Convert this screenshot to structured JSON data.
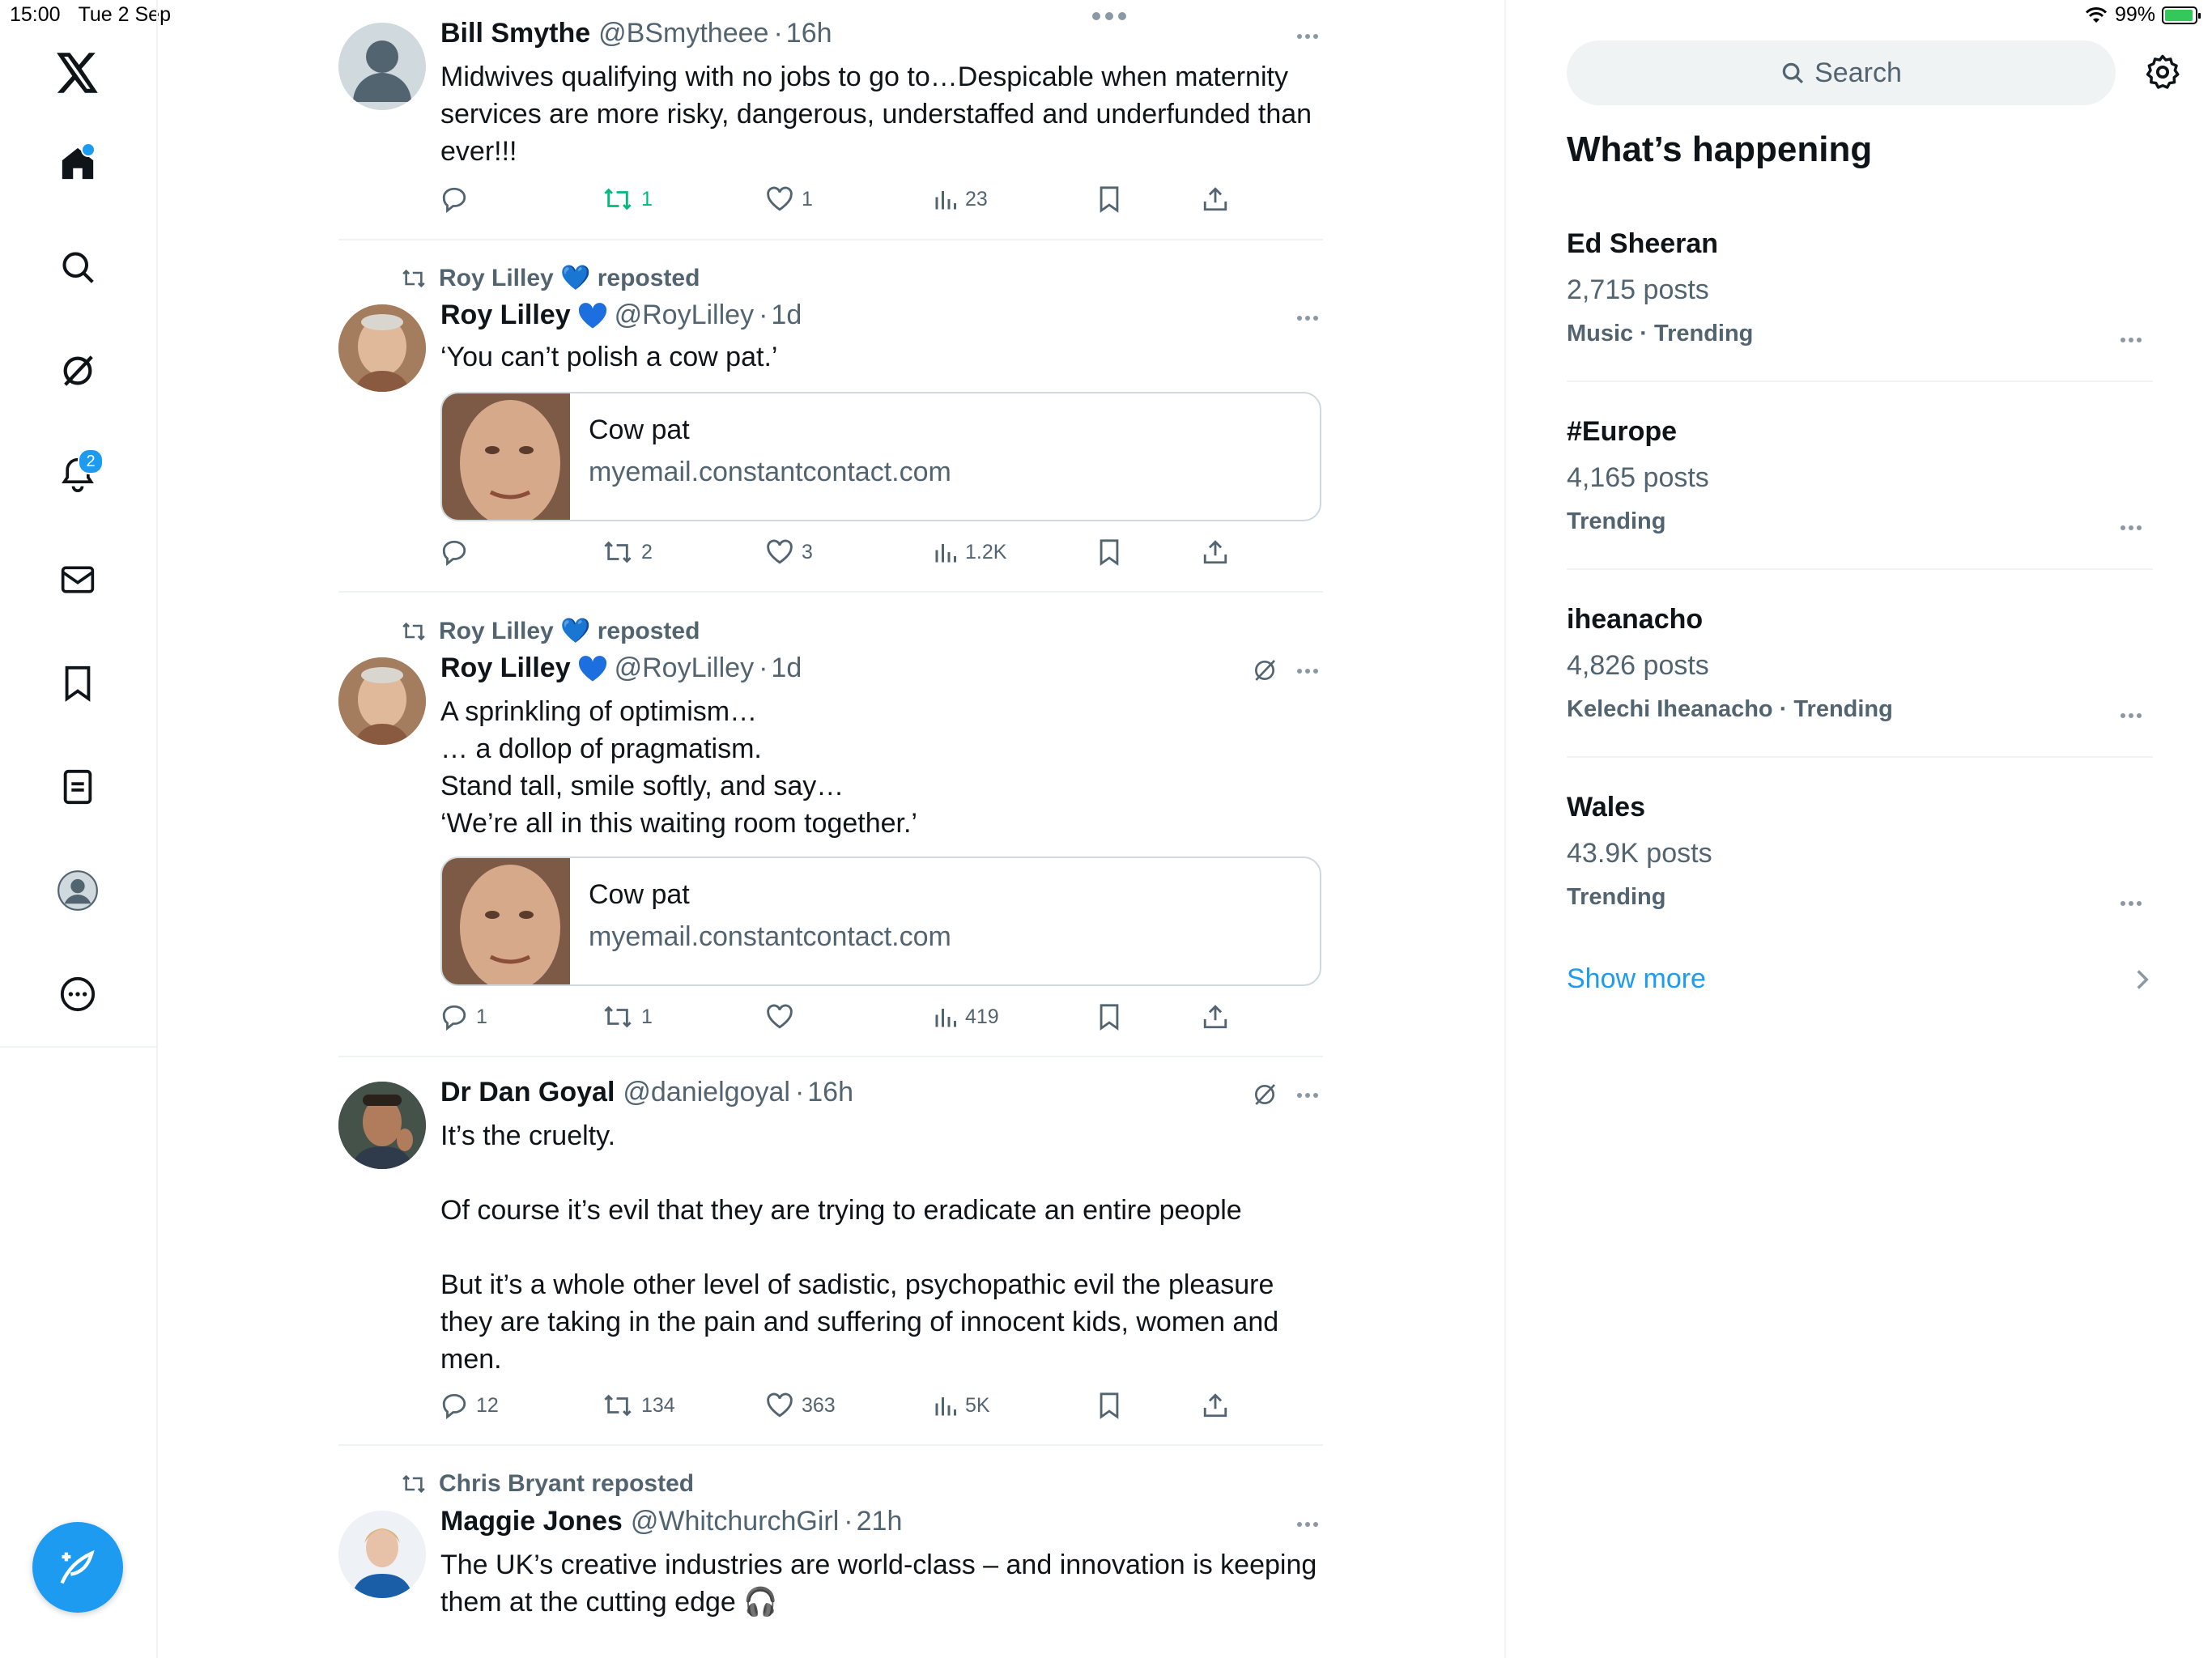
{
  "status_bar": {
    "time": "15:00",
    "date": "Tue 2 Sep",
    "battery": "99%"
  },
  "nav": {
    "items": [
      {
        "name": "x-logo"
      },
      {
        "name": "home"
      },
      {
        "name": "search"
      },
      {
        "name": "grok"
      },
      {
        "name": "notifications",
        "badge": "2"
      },
      {
        "name": "messages"
      },
      {
        "name": "bookmarks"
      },
      {
        "name": "lists"
      },
      {
        "name": "profile"
      },
      {
        "name": "more"
      }
    ]
  },
  "tweets": [
    {
      "name": "Bill Smythe",
      "handle": "@BSmytheee",
      "time": "16h",
      "text": "Midwives qualifying with no jobs to go to…Despicable when maternity services are more risky, dangerous, understaffed and underfunded than ever!!!",
      "replies": "",
      "reposts": "1",
      "likes": "1",
      "views": "23"
    },
    {
      "repost_by": "Roy Lilley 💙 reposted",
      "name": "Roy Lilley",
      "handle": "@RoyLilley",
      "time": "1d",
      "text": "‘You can’t polish a cow pat.’",
      "card": {
        "title": "Cow pat",
        "domain": "myemail.constantcontact.com"
      },
      "replies": "",
      "reposts": "2",
      "likes": "3",
      "views": "1.2K"
    },
    {
      "repost_by": "Roy Lilley 💙 reposted",
      "name": "Roy Lilley",
      "handle": "@RoyLilley",
      "time": "1d",
      "lines": [
        "A sprinkling of optimism…",
        "… a dollop of pragmatism.",
        "Stand tall, smile softly, and say…",
        "‘We’re all in this waiting room together.’"
      ],
      "card": {
        "title": "Cow pat",
        "domain": "myemail.constantcontact.com"
      },
      "replies": "1",
      "reposts": "1",
      "likes": "",
      "views": "419"
    },
    {
      "name": "Dr Dan Goyal",
      "handle": "@danielgoyal",
      "time": "16h",
      "lines": [
        "It’s the cruelty.",
        "",
        "Of course it’s evil that they are trying to eradicate an entire people",
        "",
        "But it’s a whole other level of sadistic, psychopathic evil the pleasure they are taking in the pain and suffering of innocent kids, women and men."
      ],
      "replies": "12",
      "reposts": "134",
      "likes": "363",
      "views": "5K"
    },
    {
      "repost_by": "Chris Bryant reposted",
      "name": "Maggie Jones",
      "handle": "@WhitchurchGirl",
      "time": "21h",
      "text": "The UK’s creative industries are world-class – and innovation is keeping them at the cutting edge 🎧"
    }
  ],
  "sidebar": {
    "search_placeholder": "Search",
    "whats_happening": "What’s happening",
    "trends": [
      {
        "name": "Ed Sheeran",
        "count": "2,715 posts",
        "category": "Music · Trending"
      },
      {
        "name": "#Europe",
        "count": "4,165 posts",
        "category": "Trending"
      },
      {
        "name": "iheanacho",
        "count": "4,826 posts",
        "category": "Kelechi Iheanacho · Trending"
      },
      {
        "name": "Wales",
        "count": "43.9K posts",
        "category": "Trending"
      }
    ],
    "show_more": "Show more"
  },
  "colors": {
    "accent": "#1d9bf0",
    "muted": "#536471",
    "repost_green": "#00ba7c",
    "border": "#eff3f4"
  }
}
